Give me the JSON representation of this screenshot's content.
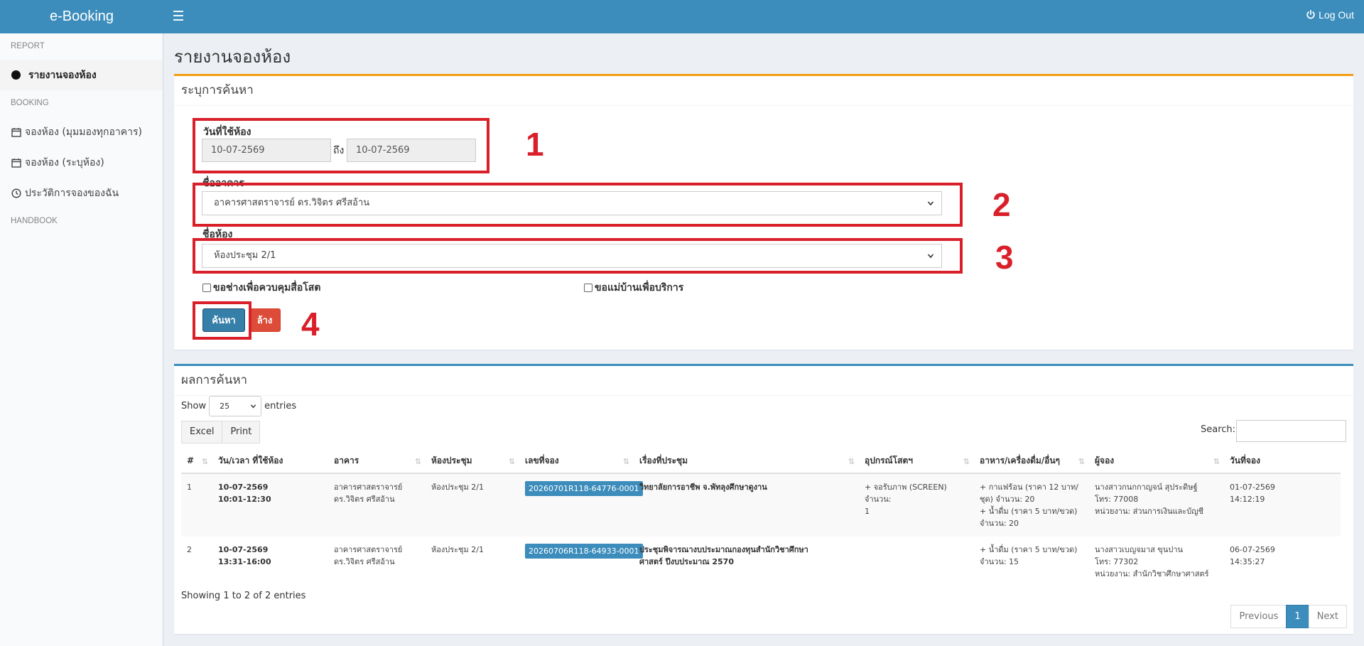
{
  "app": {
    "title": "e-Booking",
    "logout_label": "Log Out"
  },
  "sidebar": {
    "sections": [
      "REPORT",
      "BOOKING",
      "HANDBOOK"
    ],
    "items": [
      {
        "label": "รายงานจองห้อง"
      },
      {
        "label": "จองห้อง (มุมมองทุกอาคาร)"
      },
      {
        "label": "จองห้อง (ระบุห้อง)"
      },
      {
        "label": "ประวัติการจองของฉัน"
      }
    ]
  },
  "page": {
    "title": "รายงานจองห้อง"
  },
  "search": {
    "title": "ระบุการค้นหา",
    "date_label": "วันที่ใช้ห้อง",
    "date_from": "10-07-2569",
    "to_label": "ถึง",
    "date_to": "10-07-2569",
    "building_label": "ชื่ออาคาร",
    "building_value": "อาคารศาสตราจารย์ ดร.วิจิตร ศรีสอ้าน",
    "room_label": "ชื่อห้อง",
    "room_value": "ห้องประชุม 2/1",
    "checkbox_av": "ขอช่างเพื่อควบคุมสื่อโสต",
    "checkbox_maid": "ขอแม่บ้านเพื่อบริการ",
    "search_button": "ค้นหา",
    "clear_button": "ล้าง"
  },
  "annotations": [
    "1",
    "2",
    "3",
    "4"
  ],
  "results": {
    "title": "ผลการค้นหา",
    "show_label": "Show",
    "entries_label": "entries",
    "page_length": "25",
    "excel_button": "Excel",
    "print_button": "Print",
    "search_label": "Search:",
    "columns": [
      "#",
      "วัน/เวลา ที่ใช้ห้อง",
      "อาคาร",
      "ห้องประชุม",
      "เลขที่จอง",
      "เรื่องที่ประชุม",
      "อุปกรณ์โสตฯ",
      "อาหาร/เครื่องดื่ม/อื่นๆ",
      "ผู้จอง",
      "วันที่จอง"
    ],
    "rows": [
      {
        "num": "1",
        "date": "10-07-2569",
        "time": "10:01-12:30",
        "building_1": "อาคารศาสตราจารย์",
        "building_2": "ดร.วิจิตร ศรีสอ้าน",
        "room": "ห้องประชุม 2/1",
        "ref": "20260701R118-64776-0001",
        "topic": "วิทยาลัยการอาชีพ จ.พัทลุงศึกษาดูงาน",
        "av_1": "+ จอรับภาพ (SCREEN) จำนวน:",
        "av_2": "1",
        "food_1": "+ กาแฟร้อน (ราคา 12 บาท/",
        "food_2": "ชุด) จำนวน: 20",
        "food_3": "+ น้ำดื่ม (ราคา 5 บาท/ขวด)",
        "food_4": "จำนวน: 20",
        "booker_1": "นางสาวกนกกาญจน์ สุประดิษฐ์",
        "booker_2": "โทร: 77008",
        "booker_3": "หน่วยงาน: ส่วนการเงินและบัญชี",
        "booked_date": "01-07-2569",
        "booked_time": "14:12:19"
      },
      {
        "num": "2",
        "date": "10-07-2569",
        "time": "13:31-16:00",
        "building_1": "อาคารศาสตราจารย์",
        "building_2": "ดร.วิจิตร ศรีสอ้าน",
        "room": "ห้องประชุม 2/1",
        "ref": "20260706R118-64933-0001",
        "topic_1": "ประชุมพิจารณางบประมาณกองทุนสำนักวิชาศึกษา",
        "topic_2": "ศาสตร์ ปีงบประมาณ 2570",
        "food_1": "+ น้ำดื่ม (ราคา 5 บาท/ขวด)",
        "food_2": "จำนวน: 15",
        "booker_1": "นางสาวเบญจมาส ขุนปาน",
        "booker_2": "โทร: 77302",
        "booker_3": "หน่วยงาน: สำนักวิชาศึกษาศาสตร์",
        "booked_date": "06-07-2569",
        "booked_time": "14:35:27"
      }
    ],
    "info": "Showing 1 to 2 of 2 entries",
    "previous": "Previous",
    "page": "1",
    "next": "Next"
  },
  "colors": {
    "header": "#3c8dbc",
    "accent_search": "#f39c12",
    "annotation": "#d9202a",
    "danger": "#dd4b39"
  }
}
